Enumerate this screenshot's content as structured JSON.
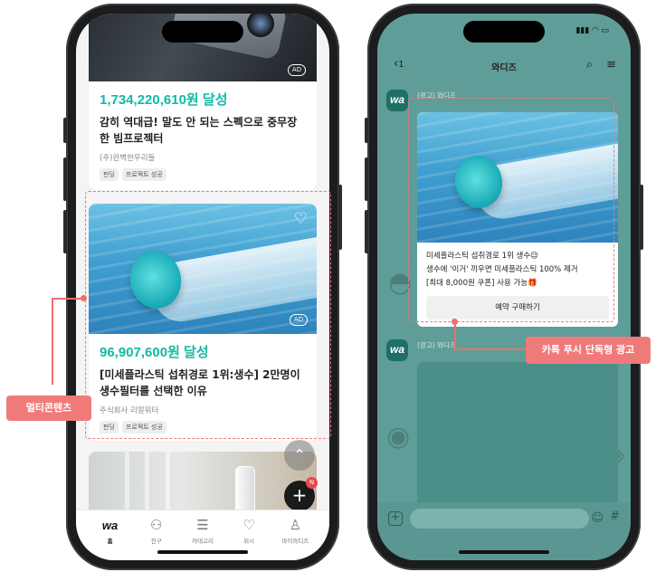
{
  "left_phone": {
    "top_ad_badge": "AD",
    "card1": {
      "amount": "1,734,220,610원 달성",
      "title": "감히 역대급! 말도 안 되는 스펙으로 중무장한 빔프로젝터",
      "company": "(주)완벽한우리들",
      "tags": [
        "펀딩",
        "프로젝트 성공"
      ]
    },
    "card2": {
      "ad_badge": "AD",
      "amount": "96,907,600원 달성",
      "title": "[미세플라스틱 섭취경로 1위:생수] 2만명이 생수필터를 선택한 이유",
      "company": "주식회사 리얼워터",
      "tags": [
        "펀딩",
        "프로젝트 성공"
      ]
    },
    "fab": {
      "scroll_up": "⌃",
      "plus": "+",
      "badge": "N"
    },
    "tabbar": [
      {
        "icon": "wa-logo",
        "label": "홈"
      },
      {
        "icon": "friends-icon",
        "label": "친구"
      },
      {
        "icon": "category-icon",
        "label": "카테고리"
      },
      {
        "icon": "heart-icon",
        "label": "위시"
      },
      {
        "icon": "person-icon",
        "label": "마이와디즈"
      }
    ],
    "logo_text": "wa"
  },
  "right_phone": {
    "header": {
      "back_count": "1",
      "title": "와디즈"
    },
    "message1": {
      "avatar": "wa",
      "sender": "(광고) 와디즈",
      "line1": "미세플라스틱 섭취경로 1위 생수😉",
      "line2": "생수에 '이거' 끼우면 미세플라스틱 100% 제거",
      "line3": "[최대 8,000원 쿠폰] 사용 가능🎁",
      "button": "예약 구매하기"
    },
    "message2": {
      "avatar": "wa",
      "sender": "(광고) 와디즈"
    },
    "input": {
      "hash": "#"
    }
  },
  "callouts": {
    "multi_content": "멀티콘텐츠",
    "kakao_push": "카톡 푸시 단독형 광고"
  },
  "colors": {
    "accent_teal": "#14b8a6",
    "callout_pink": "#f07a7a",
    "chat_bg": "#5f9d98"
  }
}
